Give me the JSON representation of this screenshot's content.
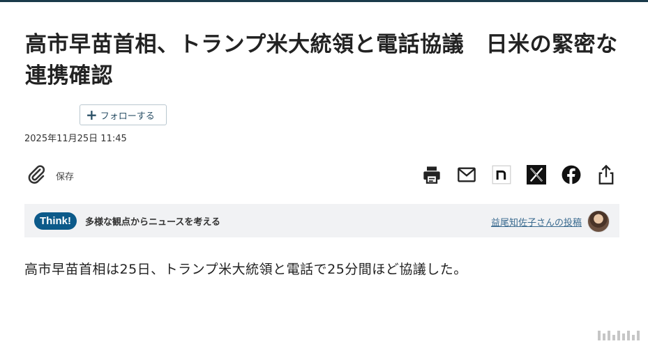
{
  "article": {
    "title": "高市早苗首相、トランプ米大統領と電話協議　日米の緊密な連携確認",
    "follow_label": "フォローする",
    "datetime": "2025年11月25日 11:45",
    "save_label": "保存",
    "body": "高市早苗首相は25日、トランプ米大統領と電話で25分間ほど協議した。"
  },
  "share_icons": [
    "printer-icon",
    "mail-icon",
    "note-icon",
    "x-icon",
    "facebook-icon",
    "share-icon"
  ],
  "think": {
    "badge": "Think!",
    "description": "多様な観点からニュースを考える",
    "link": "益尾知佐子さんの投稿"
  },
  "colors": {
    "think_badge": "#0c5a8a",
    "link": "#3a6a8f",
    "think_bar_bg": "#f1f2f4"
  }
}
